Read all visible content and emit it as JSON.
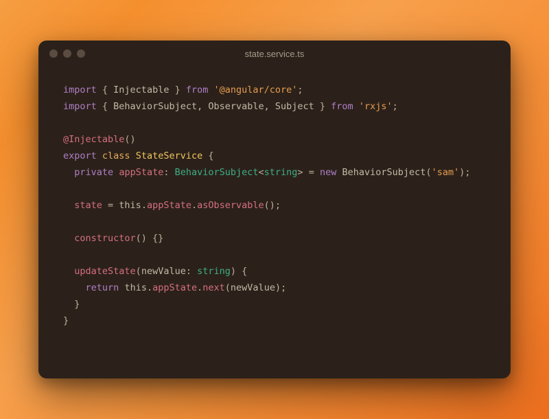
{
  "window": {
    "title": "state.service.ts"
  },
  "code": {
    "l1_import": "import",
    "l1_b1": " { ",
    "l1_injectable": "Injectable",
    "l1_b2": " } ",
    "l1_from": "from",
    "l1_sp": " ",
    "l1_pkg": "'@angular/core'",
    "l1_semi": ";",
    "l2_import": "import",
    "l2_b1": " { ",
    "l2_items": "BehaviorSubject, Observable, Subject",
    "l2_b2": " } ",
    "l2_from": "from",
    "l2_sp": " ",
    "l2_pkg": "'rxjs'",
    "l2_semi": ";",
    "l4_decorator": "@Injectable",
    "l4_parens": "()",
    "l5_export": "export",
    "l5_sp1": " ",
    "l5_class": "class",
    "l5_sp2": " ",
    "l5_name": "StateService",
    "l5_brace": " {",
    "l6_indent": "  ",
    "l6_private": "private",
    "l6_sp1": " ",
    "l6_prop": "appState",
    "l6_colon": ": ",
    "l6_type1": "BehaviorSubject",
    "l6_lt": "<",
    "l6_type2": "string",
    "l6_gt": ">",
    "l6_eq": " = ",
    "l6_new": "new",
    "l6_sp2": " ",
    "l6_ctor": "BehaviorSubject",
    "l6_arg_open": "(",
    "l6_arg": "'sam'",
    "l6_arg_close": ");",
    "l8_indent": "  ",
    "l8_prop": "state",
    "l8_eq": " = ",
    "l8_this": "this",
    "l8_dot1": ".",
    "l8_appstate": "appState",
    "l8_dot2": ".",
    "l8_method": "asObservable",
    "l8_parens": "();",
    "l10_indent": "  ",
    "l10_ctor": "constructor",
    "l10_rest": "() {}",
    "l12_indent": "  ",
    "l12_method": "updateState",
    "l12_popen": "(",
    "l12_param": "newValue",
    "l12_colon": ": ",
    "l12_ptype": "string",
    "l12_pclose": ") {",
    "l13_indent": "    ",
    "l13_return": "return",
    "l13_sp": " ",
    "l13_this": "this",
    "l13_dot1": ".",
    "l13_appstate": "appState",
    "l13_dot2": ".",
    "l13_next": "next",
    "l13_popen": "(",
    "l13_arg": "newValue",
    "l13_pclose": ");",
    "l14_indent": "  ",
    "l14_brace": "}",
    "l15_brace": "}"
  }
}
